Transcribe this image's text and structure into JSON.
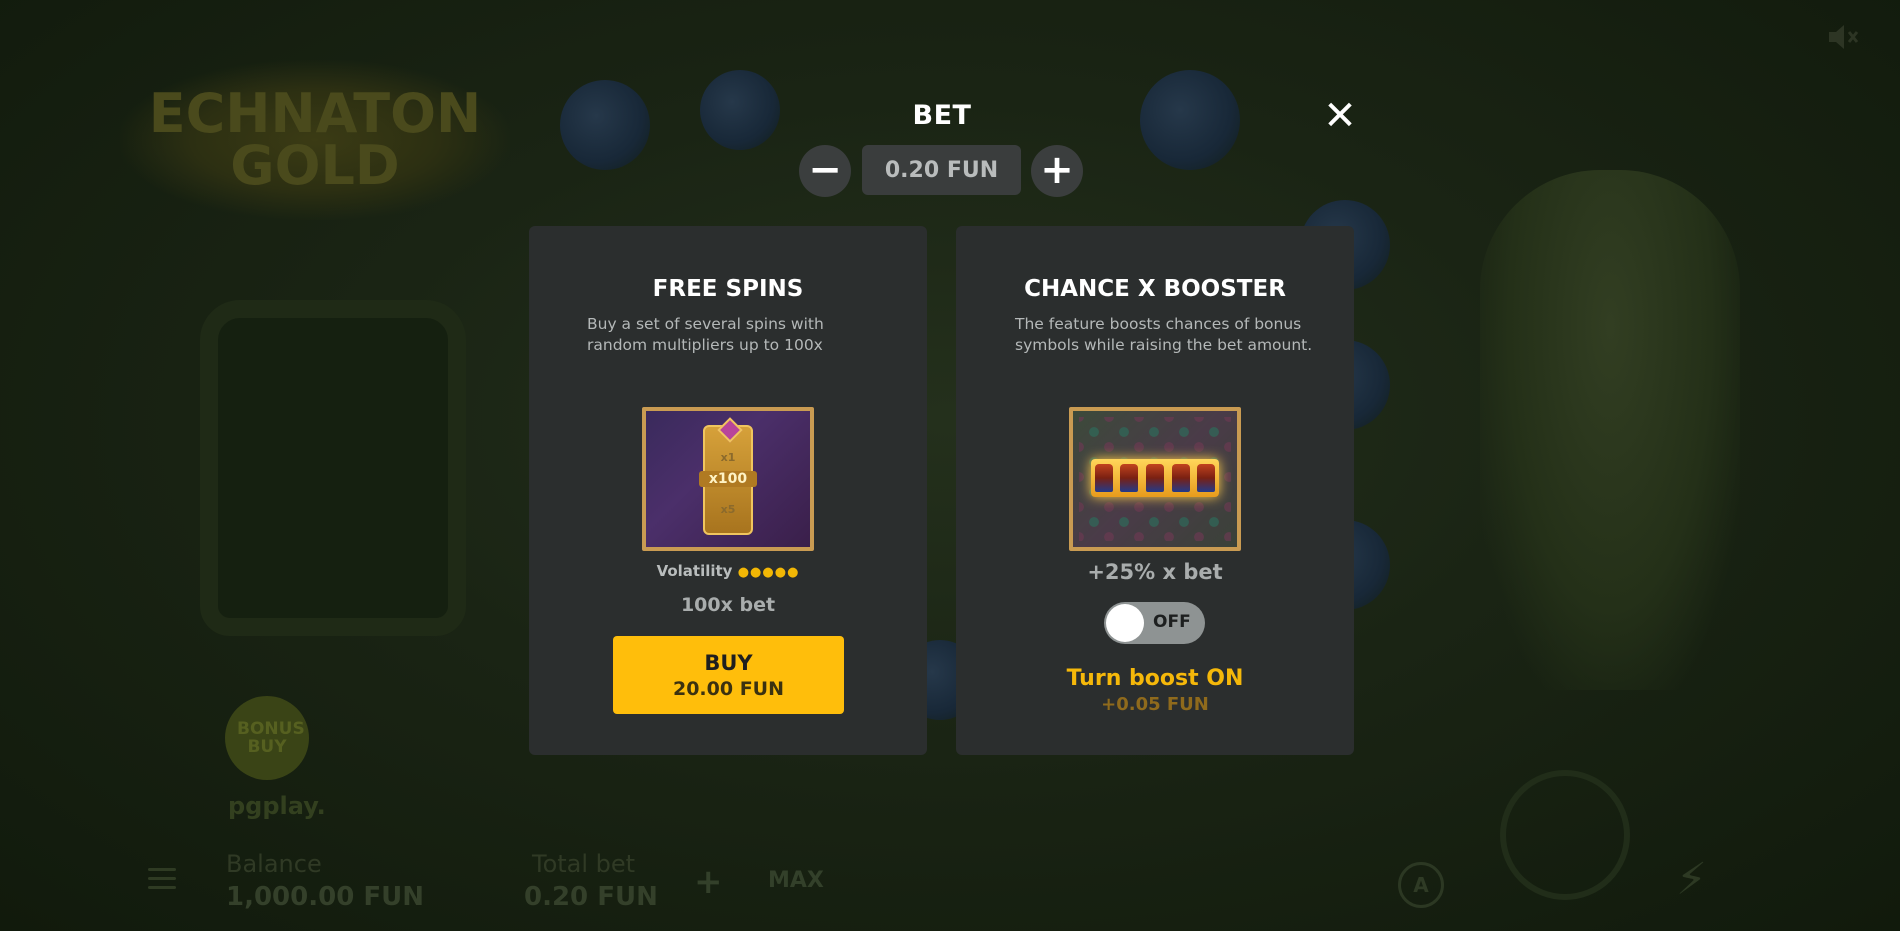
{
  "background": {
    "logo_text": "ECHNATON GOLD",
    "bonus_buy_label": "BONUS BUY",
    "provider": "pgplay.",
    "balance_label": "Balance",
    "balance_value": "1,000.00 FUN",
    "total_bet_label": "Total bet",
    "total_bet_value": "0.20 FUN",
    "max_label": "MAX",
    "plus_label": "+",
    "autoplay_label": "A"
  },
  "modal": {
    "title": "BET",
    "close_label": "✕",
    "minus_label": "−",
    "plus_label": "+",
    "bet_value": "0.20 FUN"
  },
  "free_spins": {
    "title": "FREE SPINS",
    "description": "Buy a set of several spins with random multipliers up to 100x",
    "multiplier": "x100",
    "multiplier_above": "x1",
    "multiplier_below": "x5",
    "volatility_label": "Volatility",
    "volatility_dots": "●●●●●",
    "volatility_level": 5,
    "bet_multiplier": "100x bet",
    "buy_label": "BUY",
    "buy_price": "20.00 FUN"
  },
  "booster": {
    "title": "CHANCE X BOOSTER",
    "description": "The feature boosts chances of bonus symbols while raising the bet amount.",
    "boost_percent": "+25% x bet",
    "toggle_state": "OFF",
    "turn_on_label": "Turn boost ON",
    "turn_on_price": "+0.05 FUN"
  },
  "colors": {
    "accent": "#ffbe0b",
    "panel": "#2b2e2e",
    "overlay_bg": "#1a2414"
  }
}
